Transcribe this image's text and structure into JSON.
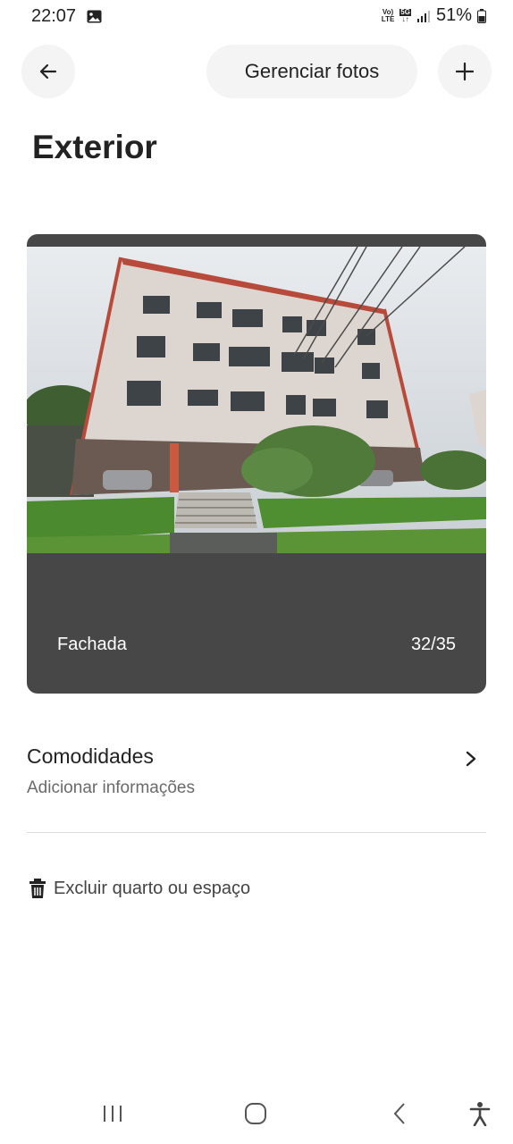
{
  "status_bar": {
    "time": "22:07",
    "network_top": "Vo)",
    "network_bottom": "LTE",
    "gen": "5G",
    "battery": "51%"
  },
  "header": {
    "manage_label": "Gerenciar fotos"
  },
  "page": {
    "title": "Exterior"
  },
  "photo": {
    "caption": "Fachada",
    "counter": "32/35"
  },
  "amenities": {
    "title": "Comodidades",
    "subtitle": "Adicionar informações"
  },
  "delete": {
    "label": "Excluir quarto ou espaço"
  },
  "icons": [
    "back-arrow-icon",
    "plus-icon",
    "chevron-right-icon",
    "trash-icon",
    "recent-apps-icon",
    "home-icon",
    "back-icon",
    "accessibility-icon"
  ]
}
